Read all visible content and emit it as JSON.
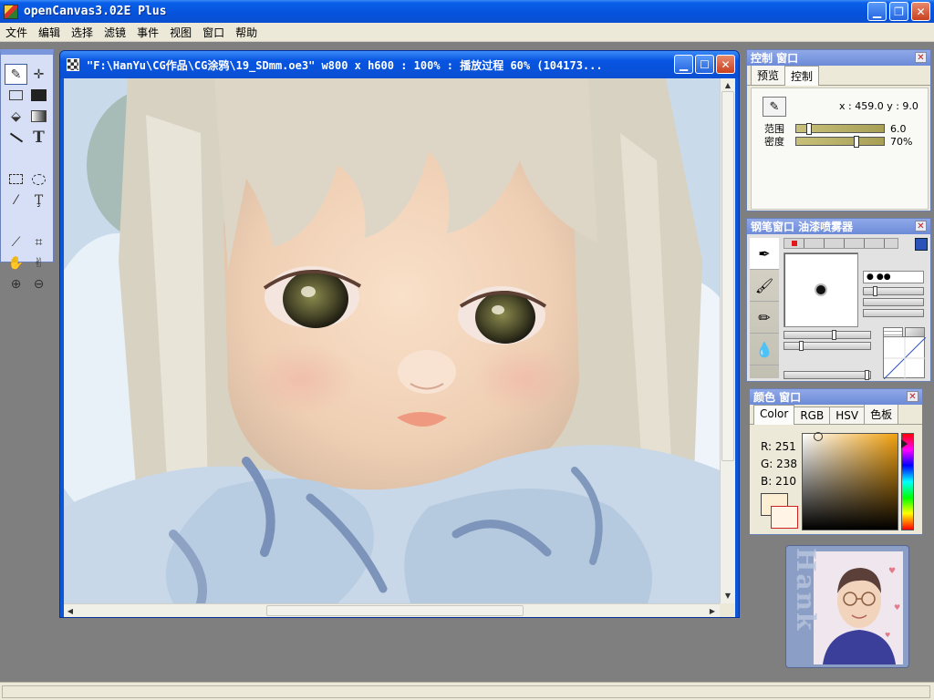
{
  "app": {
    "title": "openCanvas3.02E Plus"
  },
  "menu": [
    "文件",
    "编辑",
    "选择",
    "滤镜",
    "事件",
    "视图",
    "窗口",
    "帮助"
  ],
  "document": {
    "title": "\"F:\\HanYu\\CG作品\\CG涂鸦\\19_SDmm.oe3\" w800 x h600 : 100% : 播放过程 60% (104173..."
  },
  "control_window": {
    "title": "控制 窗口",
    "tabs": [
      "预览",
      "控制"
    ],
    "active_tab": "控制",
    "coords": "x : 459.0  y : 9.0",
    "range_label": "范围",
    "range_value": "6.0",
    "range_fraction": 0.12,
    "density_label": "密度",
    "density_value": "70%",
    "density_fraction": 0.7
  },
  "brush_window": {
    "title": "钢笔窗口  油漆喷雾器"
  },
  "color_window": {
    "title": "颜色 窗口",
    "tabs": [
      "Color",
      "RGB",
      "HSV",
      "色板"
    ],
    "active_tab": "Color",
    "r": "R: 251",
    "g": "G: 238",
    "b": "B: 210",
    "foreground": "#fbeed2"
  },
  "avatar": {
    "name": "Hank"
  },
  "icons": {
    "toolbox": [
      "pen-icon",
      "move-icon",
      "rect-outline-icon",
      "rect-fill-icon",
      "bucket-icon",
      "gradient-icon",
      "line-icon",
      "text-icon",
      "rect-select-icon",
      "lasso-select-icon",
      "magic-wand-icon",
      "text-select-icon",
      "eyedropper-icon",
      "crop-icon",
      "hand-icon",
      "rotate-hand-icon",
      "zoom-in-icon",
      "zoom-out-icon"
    ]
  },
  "colors": {
    "titlebar": "#0553dc",
    "accent": "#6c8ad8",
    "desktop": "#7f7f7f"
  }
}
